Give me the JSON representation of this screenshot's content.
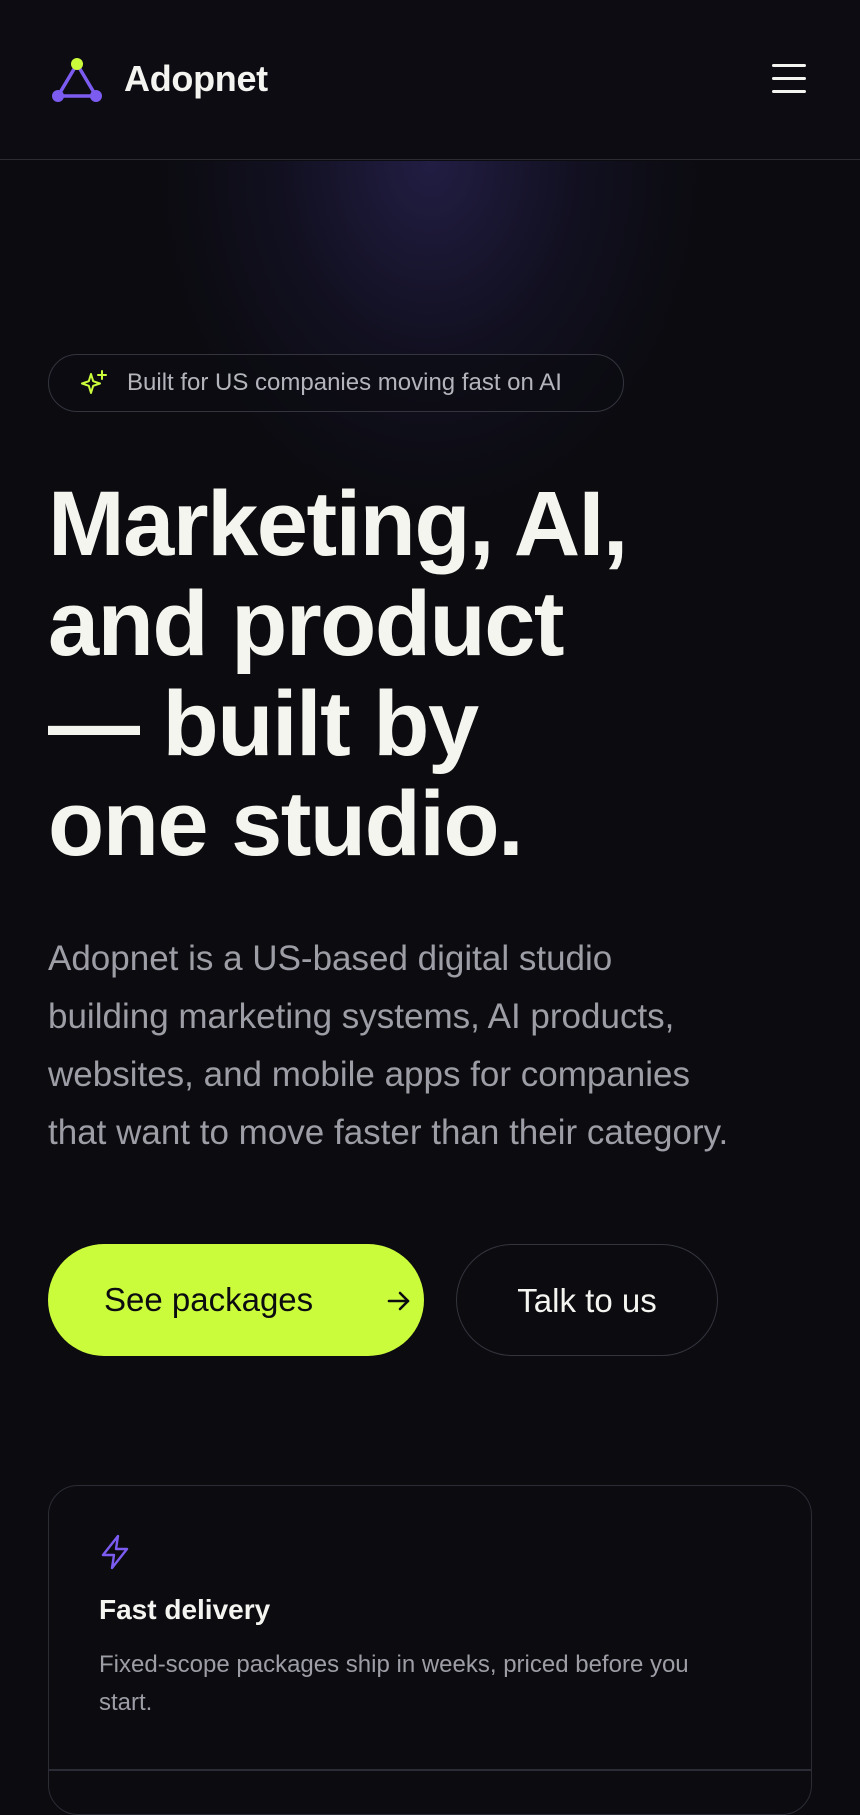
{
  "header": {
    "brand": "Adopnet",
    "logo_icon": "triangle-nodes-logo-icon",
    "menu_icon": "hamburger-menu-icon"
  },
  "hero": {
    "badge": {
      "icon": "sparkle-icon",
      "text": "Built for US companies moving fast on AI"
    },
    "headline_lines": [
      "Marketing, AI,",
      "and product",
      "— built by",
      "one studio."
    ],
    "subtitle_lines": [
      "Adopnet is a US-based digital studio",
      "building marketing systems, AI products,",
      "websites, and mobile apps for companies",
      "that want to move faster than their category."
    ],
    "primary_cta": {
      "label": "See packages",
      "icon": "arrow-right-icon"
    },
    "secondary_cta": {
      "label": "Talk to us"
    }
  },
  "features": [
    {
      "icon": "lightning-bolt-icon",
      "title": "Fast delivery",
      "description": "Fixed-scope packages ship in weeks, priced before you start."
    }
  ],
  "colors": {
    "background": "#0b0b10",
    "accent_lime": "#cbfc3c",
    "accent_purple": "#7c5cf0",
    "text_primary": "#f4f4f0",
    "text_muted": "#9d9da6",
    "border": "#34343e"
  }
}
